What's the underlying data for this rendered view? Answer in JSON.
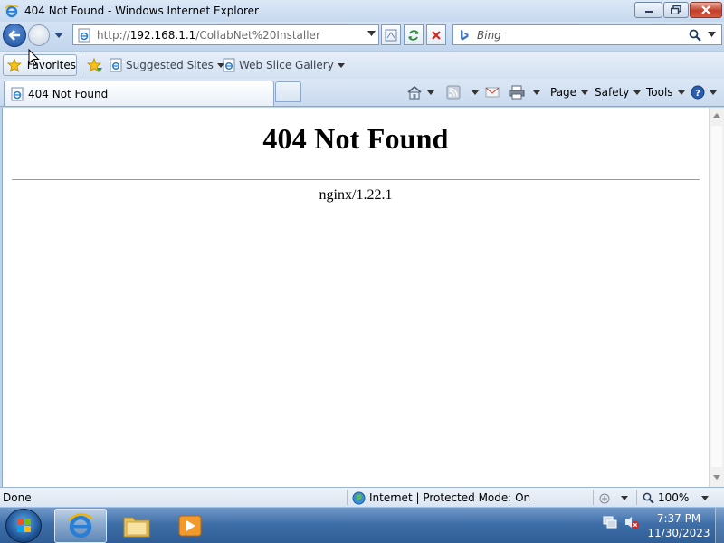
{
  "window": {
    "title": "404 Not Found - Windows Internet Explorer"
  },
  "address_bar": {
    "url_prefix": "http://",
    "url_host": "192.168.1.1",
    "url_path": "/CollabNet%20Installer"
  },
  "search": {
    "placeholder": "Bing"
  },
  "favorites_bar": {
    "favorites_label": "Favorites",
    "items": [
      {
        "label": "Suggested Sites"
      },
      {
        "label": "Web Slice Gallery"
      }
    ]
  },
  "tabs": [
    {
      "label": "404 Not Found"
    }
  ],
  "command_bar": {
    "page_label": "Page",
    "safety_label": "Safety",
    "tools_label": "Tools"
  },
  "page": {
    "heading": "404 Not Found",
    "server": "nginx/1.22.1"
  },
  "status_bar": {
    "status": "Done",
    "zone": "Internet | Protected Mode: On",
    "zoom": "100%"
  },
  "taskbar": {
    "time": "7:37 PM",
    "date": "11/30/2023"
  },
  "colors": {
    "chrome_blue": "#c6d9ef",
    "taskbar_blue": "#3f6fa8",
    "close_red": "#c2402a"
  }
}
